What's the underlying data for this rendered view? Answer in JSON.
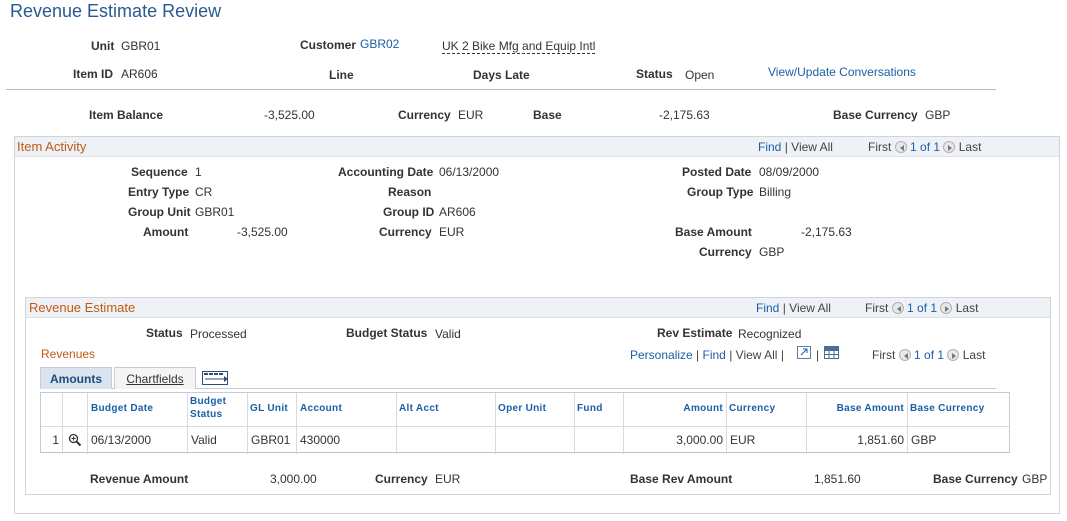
{
  "page": {
    "title": "Revenue Estimate Review"
  },
  "header": {
    "unit_label": "Unit",
    "unit_value": "GBR01",
    "customer_label": "Customer",
    "customer_id": "GBR02",
    "customer_name": "UK 2 Bike Mfg and Equip Intl",
    "item_id_label": "Item ID",
    "item_id_value": "AR606",
    "line_label": "Line",
    "days_late_label": "Days Late",
    "status_label": "Status",
    "status_value": "Open",
    "view_conversations": "View/Update Conversations",
    "item_balance_label": "Item Balance",
    "item_balance_value": "-3,525.00",
    "currency_label": "Currency",
    "currency_value": "EUR",
    "base_label": "Base",
    "base_value": "-2,175.63",
    "base_currency_label": "Base Currency",
    "base_currency_value": "GBP"
  },
  "item_activity": {
    "title": "Item Activity",
    "nav": {
      "find": "Find",
      "sep": "|",
      "view_all": "View All",
      "first": "First",
      "count": "1 of 1",
      "last": "Last"
    },
    "sequence_label": "Sequence",
    "sequence_value": "1",
    "accounting_date_label": "Accounting Date",
    "accounting_date_value": "06/13/2000",
    "posted_date_label": "Posted Date",
    "posted_date_value": "08/09/2000",
    "entry_type_label": "Entry Type",
    "entry_type_value": "CR",
    "reason_label": "Reason",
    "group_type_label": "Group Type",
    "group_type_value": "Billing",
    "group_unit_label": "Group Unit",
    "group_unit_value": "GBR01",
    "group_id_label": "Group ID",
    "group_id_value": "AR606",
    "amount_label": "Amount",
    "amount_value": "-3,525.00",
    "currency_label": "Currency",
    "currency_value": "EUR",
    "base_amount_label": "Base Amount",
    "base_amount_value": "-2,175.63",
    "base_currency_label": "Currency",
    "base_currency_value": "GBP"
  },
  "revenue_estimate": {
    "title": "Revenue Estimate",
    "nav": {
      "find": "Find",
      "sep": "|",
      "view_all": "View All",
      "first": "First",
      "count": "1 of 1",
      "last": "Last"
    },
    "status_label": "Status",
    "status_value": "Processed",
    "budget_status_label": "Budget Status",
    "budget_status_value": "Valid",
    "rev_estimate_label": "Rev Estimate",
    "rev_estimate_value": "Recognized"
  },
  "revenues": {
    "title": "Revenues",
    "nav": {
      "personalize": "Personalize",
      "sep": "|",
      "find": "Find",
      "view_all": "View All",
      "first": "First",
      "count": "1 of 1",
      "last": "Last"
    },
    "tabs": {
      "amounts": "Amounts",
      "chartfields": "Chartfields"
    },
    "columns": {
      "budget_date": "Budget Date",
      "budget_status_1": "Budget",
      "budget_status_2": "Status",
      "gl_unit": "GL Unit",
      "account": "Account",
      "alt_acct": "Alt Acct",
      "oper_unit": "Oper Unit",
      "fund": "Fund",
      "amount": "Amount",
      "currency": "Currency",
      "base_amount": "Base Amount",
      "base_currency": "Base Currency"
    },
    "rows": [
      {
        "num": "1",
        "budget_date": "06/13/2000",
        "budget_status": "Valid",
        "gl_unit": "GBR01",
        "account": "430000",
        "alt_acct": "",
        "oper_unit": "",
        "fund": "",
        "amount": "3,000.00",
        "currency": "EUR",
        "base_amount": "1,851.60",
        "base_currency": "GBP"
      }
    ]
  },
  "totals": {
    "revenue_amount_label": "Revenue Amount",
    "revenue_amount_value": "3,000.00",
    "currency_label": "Currency",
    "currency_value": "EUR",
    "base_rev_amount_label": "Base Rev Amount",
    "base_rev_amount_value": "1,851.60",
    "base_currency_label": "Base Currency",
    "base_currency_value": "GBP"
  },
  "colors": {
    "link": "#1a5fa6",
    "section_title": "#c05a13",
    "page_title": "#29598f"
  }
}
